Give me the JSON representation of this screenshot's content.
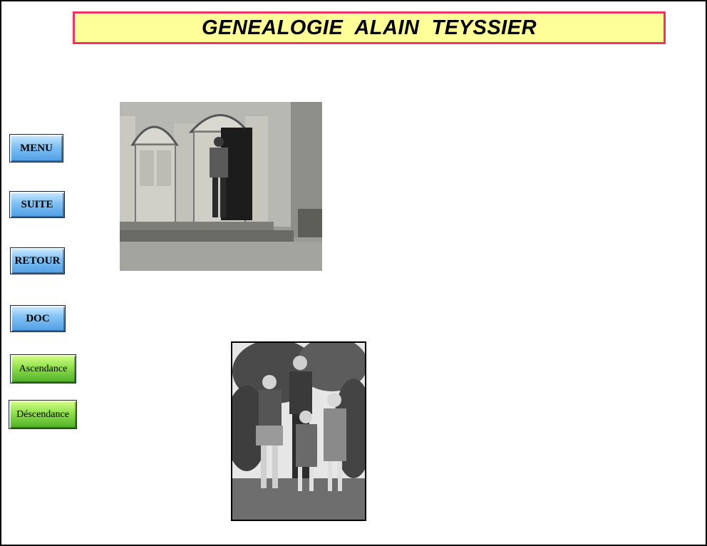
{
  "header": {
    "title": "GENEALOGIE  ALAIN  TEYSSIER"
  },
  "nav": {
    "menu": "MENU",
    "suite": "SUITE",
    "retour": "RETOUR",
    "doc": "DOC",
    "ascendance": "Ascendance",
    "descendance": "Déscendance"
  },
  "colors": {
    "title_bg": "#ffff99",
    "title_border": "#ee3366",
    "nav_blue": "#7fc1f5",
    "nav_green": "#8fe04a"
  }
}
